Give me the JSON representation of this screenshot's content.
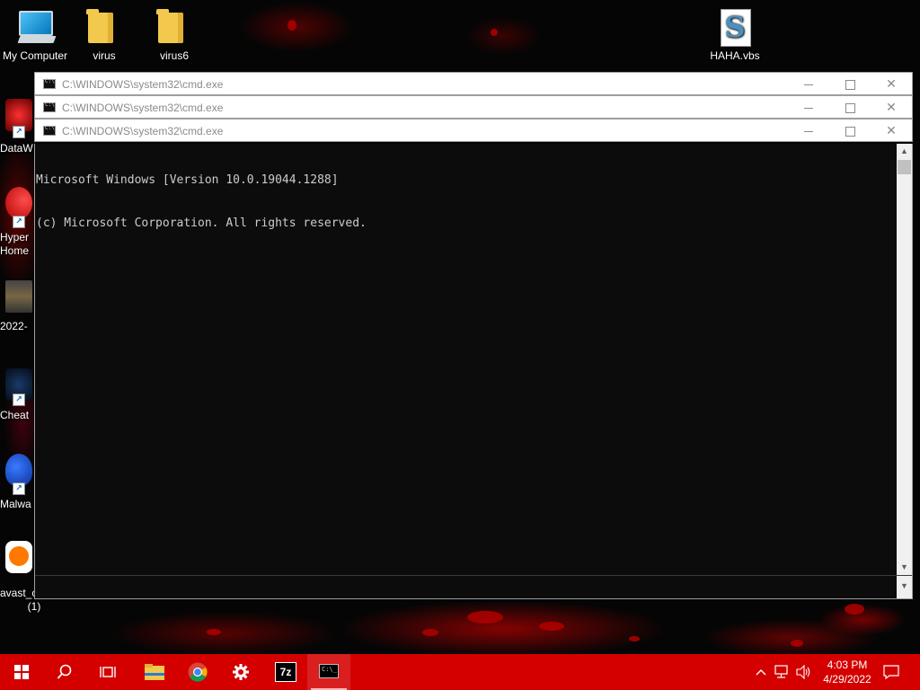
{
  "desktop": {
    "icons": [
      {
        "label": "My Computer",
        "icon": "computer-icon"
      },
      {
        "label": "virus",
        "icon": "folder-icon"
      },
      {
        "label": "virus6",
        "icon": "folder-icon"
      },
      {
        "label": "HAHA.vbs",
        "icon": "vbs-script-icon"
      }
    ],
    "left_icons": [
      {
        "label": "DataW",
        "icon": "datawatch-icon"
      },
      {
        "label": "Hyper",
        "label2": "Home",
        "icon": "hyper-icon"
      },
      {
        "label": "2022-",
        "icon": "video-file-icon"
      },
      {
        "label": "Cheat",
        "icon": "cheat-icon"
      },
      {
        "label": "Malwa",
        "icon": "malwarebytes-icon"
      },
      {
        "label": "avast_c",
        "label2": "(1)",
        "icon": "avast-icon"
      }
    ]
  },
  "windows": [
    {
      "title": "C:\\WINDOWS\\system32\\cmd.exe"
    },
    {
      "title": "C:\\WINDOWS\\system32\\cmd.exe"
    },
    {
      "title": "C:\\WINDOWS\\system32\\cmd.exe"
    }
  ],
  "console": {
    "lines": [
      "Microsoft Windows [Version 10.0.19044.1288]",
      "(c) Microsoft Corporation. All rights reserved."
    ]
  },
  "taskbar": {
    "items": [
      "start-icon",
      "search-icon",
      "task-view-icon",
      "file-explorer-icon",
      "chrome-icon",
      "settings-icon",
      "7zip-icon",
      "cmd-icon"
    ],
    "time": "4:03 PM",
    "date": "4/29/2022",
    "color": "#d40000"
  }
}
